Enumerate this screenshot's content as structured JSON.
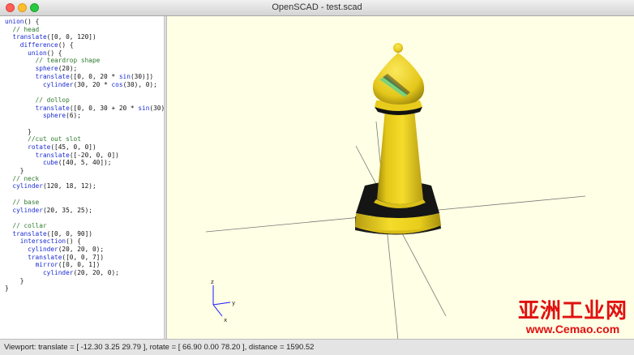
{
  "window": {
    "title": "OpenSCAD - test.scad"
  },
  "editor": {
    "lines": [
      "union() {",
      "  // head",
      "  translate([0, 0, 120])",
      "    difference() {",
      "      union() {",
      "        // teardrop shape",
      "        sphere(20);",
      "        translate([0, 0, 20 * sin(30)])",
      "          cylinder(30, 20 * cos(30), 0);",
      "",
      "        // dollop",
      "        translate([0, 0, 30 + 20 * sin(30)])",
      "          sphere(6);",
      "",
      "      }",
      "      //cut out slot",
      "      rotate([45, 0, 0])",
      "        translate([-20, 0, 0])",
      "          cube([40, 5, 40]);",
      "    }",
      "  // neck",
      "  cylinder(120, 18, 12);",
      "",
      "  // base",
      "  cylinder(20, 35, 25);",
      "",
      "  // collar",
      "  translate([0, 0, 90])",
      "    intersection() {",
      "      cylinder(20, 20, 0);",
      "      translate([0, 0, 7])",
      "        mirror([0, 0, 1])",
      "          cylinder(20, 20, 0);",
      "    }",
      "}"
    ]
  },
  "viewport": {
    "background": "#ffffe5",
    "model_color": "#f2d21a",
    "axis_label_z": "z",
    "axis_label_y": "y",
    "axis_label_x": "x"
  },
  "statusbar": {
    "text": "Viewport: translate = [ -12.30 3.25 29.79 ], rotate = [ 66.90 0.00 78.20 ], distance = 1590.52"
  },
  "watermark": {
    "chinese": "亚洲工业网",
    "url": "www.Cemao.com"
  }
}
